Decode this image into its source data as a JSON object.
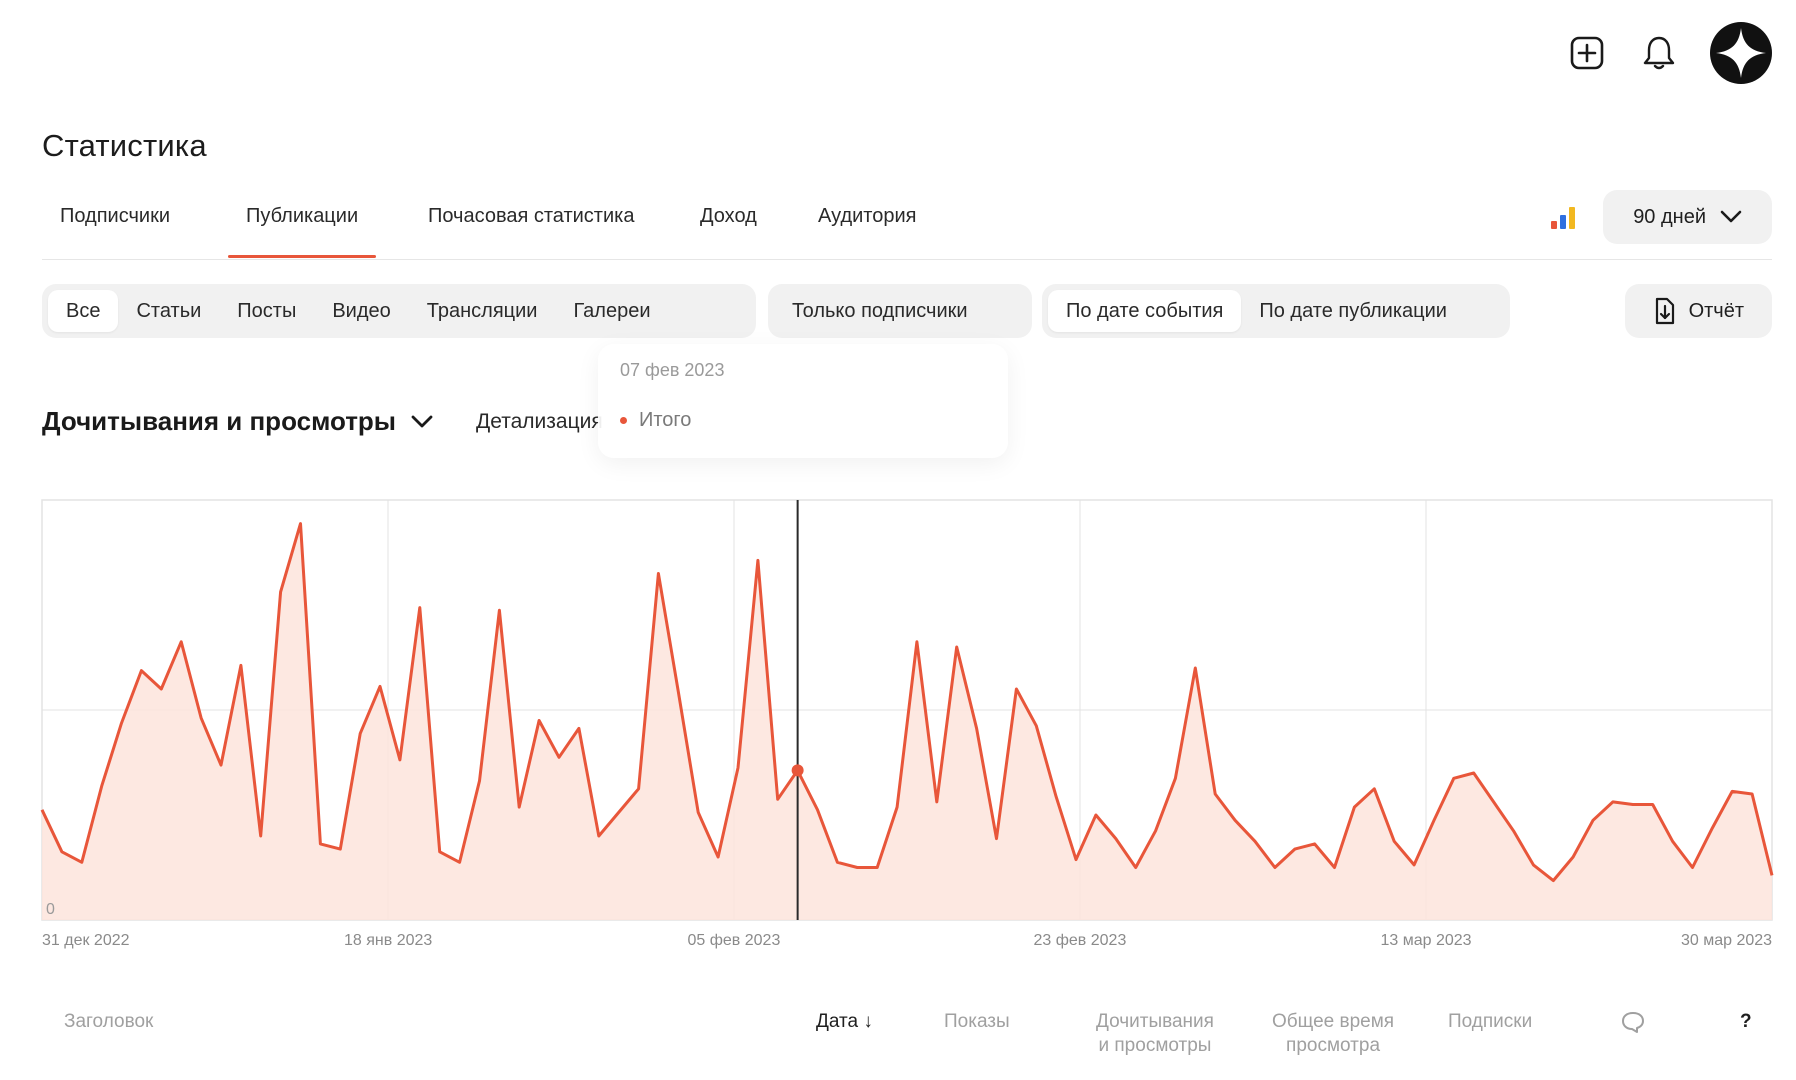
{
  "header": {
    "title": "Статистика",
    "icons": {
      "create": "plus-square-icon",
      "notifications": "bell-icon",
      "avatar": "star-avatar-icon"
    }
  },
  "tabs": [
    {
      "label": "Подписчики",
      "active": false
    },
    {
      "label": "Публикации",
      "active": true
    },
    {
      "label": "Почасовая статистика",
      "active": false
    },
    {
      "label": "Доход",
      "active": false
    },
    {
      "label": "Аудитория",
      "active": false
    }
  ],
  "period": {
    "label": "90 дней",
    "icon": "chevron-down-icon"
  },
  "filters": {
    "types": [
      "Все",
      "Статьи",
      "Посты",
      "Видео",
      "Трансляции",
      "Галереи"
    ],
    "active_type": "Все",
    "subscribers_only": "Только подписчики",
    "date_modes": [
      "По дате события",
      "По дате публикации"
    ],
    "active_date_mode": "По дате события",
    "report": "Отчёт"
  },
  "tooltip": {
    "date": "07 фев 2023",
    "series": "Итого"
  },
  "metric": {
    "label": "Дочитывания и просмотры",
    "detail": "Детализация"
  },
  "colors": {
    "accent": "#e8563a",
    "fill": "#fde4dc",
    "grid": "#e3e3e3"
  },
  "chart_data": {
    "type": "area",
    "series": [
      {
        "name": "Итого",
        "values": [
          42,
          26,
          22,
          51,
          75,
          95,
          88,
          106,
          77,
          59,
          97,
          32,
          125,
          151,
          29,
          27,
          71,
          89,
          61,
          119,
          26,
          22,
          53,
          118,
          43,
          76,
          62,
          73,
          32,
          41,
          50,
          132,
          87,
          41,
          24,
          58,
          137,
          46,
          57,
          42,
          22,
          20,
          20,
          43,
          106,
          45,
          104,
          73,
          31,
          88,
          74,
          47,
          23,
          40,
          31,
          20,
          34,
          54,
          96,
          48,
          38,
          30,
          20,
          27,
          29,
          20,
          43,
          50,
          30,
          21,
          38,
          54,
          56,
          45,
          34,
          21,
          15,
          24,
          38,
          45,
          44,
          44,
          30,
          20,
          35,
          49,
          48,
          17
        ]
      }
    ],
    "x_tick_labels": [
      "31 дек 2022",
      "18 янв 2023",
      "05 фев 2023",
      "23 фев 2023",
      "13 мар 2023",
      "30 мар 2023"
    ],
    "y_tick_labels": [
      "0"
    ],
    "ylim": [
      0,
      160
    ],
    "highlight": {
      "label": "07 фев 2023",
      "index": 38
    },
    "grid": true
  },
  "table_header": {
    "title": "Заголовок",
    "date": "Дата ↓",
    "impressions": "Показы",
    "reads_line1": "Дочитывания",
    "reads_line2": "и просмотры",
    "time_line1": "Общее время",
    "time_line2": "просмотра",
    "subscriptions": "Подписки",
    "comments_icon": "comment-icon",
    "help": "?"
  }
}
